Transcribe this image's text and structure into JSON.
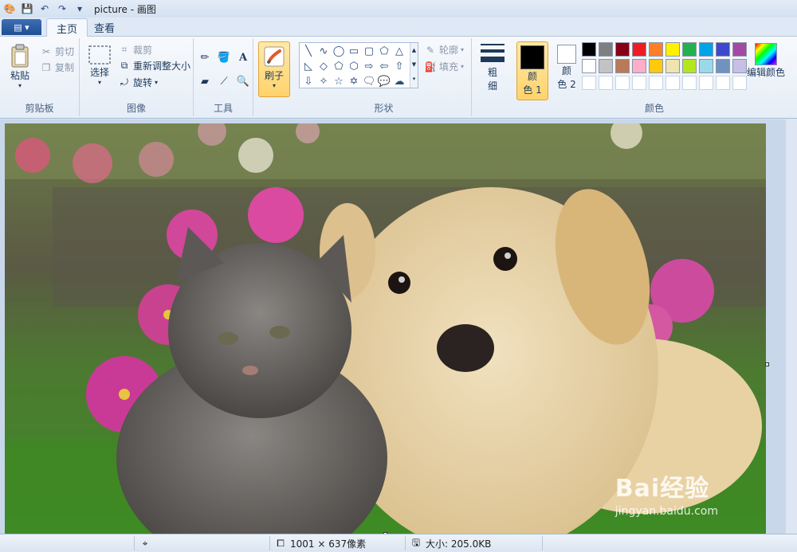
{
  "window": {
    "title": "picture - 画图"
  },
  "tabs": [
    {
      "label": "主页",
      "active": true
    },
    {
      "label": "查看",
      "active": false
    }
  ],
  "clipboard": {
    "paste": "粘贴",
    "cut": "剪切",
    "copy": "复制",
    "label": "剪贴板"
  },
  "image": {
    "select": "选择",
    "crop": "裁剪",
    "resize": "重新调整大小",
    "rotate": "旋转",
    "label": "图像"
  },
  "tools": {
    "label": "工具"
  },
  "brushes": {
    "label": "刷子"
  },
  "shapes": {
    "outline": "轮廓",
    "fill": "填充",
    "label": "形状"
  },
  "size": {
    "label_line1": "粗",
    "label_line2": "细"
  },
  "colors": {
    "color1_line1": "颜",
    "color1_line2": "色 1",
    "color2_line1": "颜",
    "color2_line2": "色 2",
    "edit": "编辑颜色",
    "label": "颜色",
    "palette_row1": [
      "#000000",
      "#7f7f7f",
      "#880015",
      "#ed1c24",
      "#ff7f27",
      "#fff200",
      "#22b14c",
      "#00a2e8",
      "#3f48cc",
      "#a349a4"
    ],
    "palette_row2": [
      "#ffffff",
      "#c3c3c3",
      "#b97a57",
      "#ffaec9",
      "#ffc90e",
      "#efe4b0",
      "#b5e61d",
      "#99d9ea",
      "#7092be",
      "#c8bfe7"
    ]
  },
  "status": {
    "dimensions": "1001 × 637像素",
    "size": "大小: 205.0KB"
  },
  "watermark": {
    "logo": "Bai经验",
    "url": "jingyan.baidu.com"
  }
}
